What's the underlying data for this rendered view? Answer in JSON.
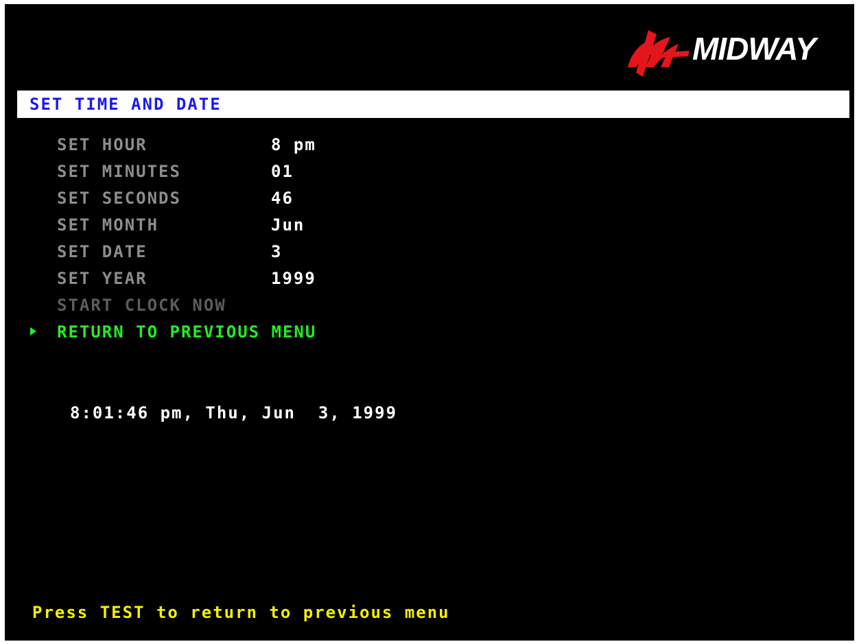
{
  "brand": {
    "logo_text": "MIDWAY",
    "logo_color": "#e3161b"
  },
  "screen": {
    "title": "SET TIME AND DATE"
  },
  "menu": {
    "items": [
      {
        "label": "SET HOUR",
        "value": "8 pm"
      },
      {
        "label": "SET MINUTES",
        "value": "01"
      },
      {
        "label": "SET SECONDS",
        "value": "46"
      },
      {
        "label": "SET MONTH",
        "value": "Jun"
      },
      {
        "label": "SET DATE",
        "value": "3"
      },
      {
        "label": "SET YEAR",
        "value": "1999"
      },
      {
        "label": "START CLOCK NOW"
      },
      {
        "label": "RETURN TO PREVIOUS MENU",
        "selected": true
      }
    ]
  },
  "clock": {
    "display": "8:01:46 pm, Thu, Jun  3, 1999"
  },
  "footer": {
    "hint": "Press TEST to return to previous menu"
  },
  "colors": {
    "background": "#000000",
    "title_bar": "#ffffff",
    "title_text": "#1a1aee",
    "menu_label": "#8c8c8c",
    "menu_label_disabled": "#5c5c5c",
    "menu_value": "#ffffff",
    "selected": "#22ee22",
    "footer": "#f4f000"
  },
  "icons": {
    "selection_pointer": "triangle-right-icon",
    "logo_mark": "midway-logo-mark-icon"
  }
}
